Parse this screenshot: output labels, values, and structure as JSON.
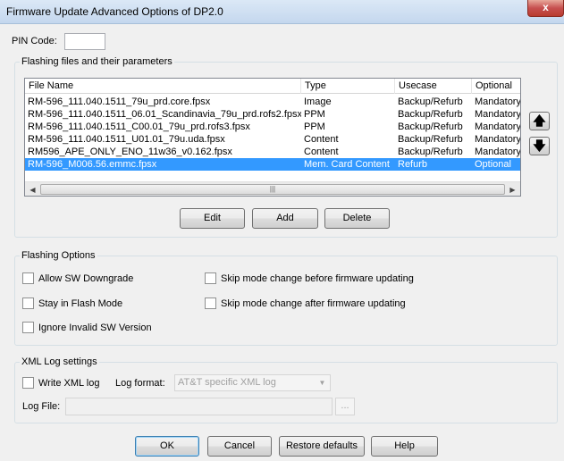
{
  "window": {
    "title": "Firmware Update Advanced Options of DP2.0",
    "close_glyph": "x"
  },
  "pin": {
    "label": "PIN Code:",
    "value": ""
  },
  "files_group": {
    "legend": "Flashing files and their parameters",
    "columns": [
      "File Name",
      "Type",
      "Usecase",
      "Optional"
    ],
    "rows": [
      {
        "file": "RM-596_111.040.1511_79u_prd.core.fpsx",
        "type": "Image",
        "usecase": "Backup/Refurb",
        "optional": "Mandatory",
        "selected": false
      },
      {
        "file": "RM-596_111.040.1511_06.01_Scandinavia_79u_prd.rofs2.fpsx",
        "type": "PPM",
        "usecase": "Backup/Refurb",
        "optional": "Mandatory",
        "selected": false
      },
      {
        "file": "RM-596_111.040.1511_C00.01_79u_prd.rofs3.fpsx",
        "type": "PPM",
        "usecase": "Backup/Refurb",
        "optional": "Mandatory",
        "selected": false
      },
      {
        "file": "RM-596_111.040.1511_U01.01_79u.uda.fpsx",
        "type": "Content",
        "usecase": "Backup/Refurb",
        "optional": "Mandatory",
        "selected": false
      },
      {
        "file": "RM596_APE_ONLY_ENO_11w36_v0.162.fpsx",
        "type": "Content",
        "usecase": "Backup/Refurb",
        "optional": "Mandatory",
        "selected": false
      },
      {
        "file": "RM-596_M006.56.emmc.fpsx",
        "type": "Mem. Card Content",
        "usecase": "Refurb",
        "optional": "Optional",
        "selected": true
      }
    ],
    "scroll_left_glyph": "◀",
    "scroll_right_glyph": "▶",
    "scroll_thumb_grip": "|||",
    "buttons": {
      "edit": "Edit",
      "add": "Add",
      "delete": "Delete"
    },
    "move_up_glyph": "🡅",
    "move_down_glyph": "🡇"
  },
  "flashing_options": {
    "legend": "Flashing Options",
    "allow_sw_downgrade": {
      "label": "Allow SW Downgrade",
      "checked": false
    },
    "stay_in_flash_mode": {
      "label": "Stay in Flash Mode",
      "checked": false
    },
    "ignore_invalid_sw": {
      "label": "Ignore Invalid SW Version",
      "checked": false
    },
    "skip_before": {
      "label": "Skip mode change before firmware updating",
      "checked": false
    },
    "skip_after": {
      "label": "Skip mode change after firmware updating",
      "checked": false
    }
  },
  "xml_log": {
    "legend": "XML Log settings",
    "write_xml_log": {
      "label": "Write XML log",
      "checked": false
    },
    "log_format_label": "Log format:",
    "log_format_value": "AT&T specific XML log",
    "dropdown_glyph": "▼",
    "log_file_label": "Log File:",
    "log_file_value": "",
    "browse_label": "..."
  },
  "footer": {
    "ok": "OK",
    "cancel": "Cancel",
    "restore": "Restore defaults",
    "help": "Help"
  }
}
